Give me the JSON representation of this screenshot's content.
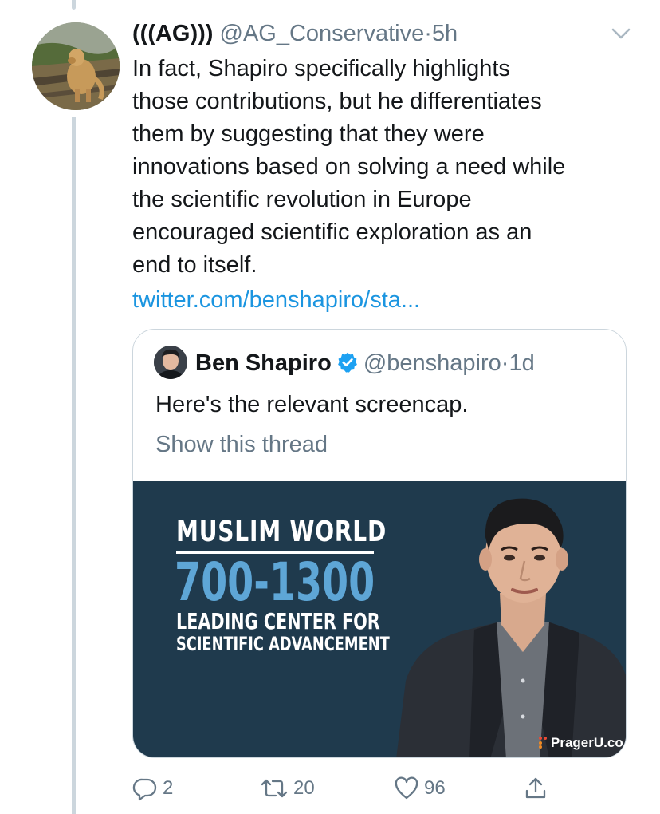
{
  "tweet": {
    "display_name": "(((AG)))",
    "handle": "@AG_Conservative",
    "separator": "·",
    "time": "5h",
    "text_lines": [
      "In fact, Shapiro specifically highlights",
      "those contributions, but he differentiates",
      "them by suggesting that they were",
      "innovations based on solving a need while",
      "the scientific revolution in Europe",
      "encouraged scientific exploration as an",
      "end to itself."
    ],
    "link": "twitter.com/benshapiro/sta...",
    "avatar_icon": "dog-photo-avatar",
    "menu_icon": "chevron-down-icon"
  },
  "quote": {
    "display_name": "Ben Shapiro",
    "handle": "@benshapiro",
    "separator": "·",
    "time": "1d",
    "text": "Here's the relevant screencap.",
    "show_thread": "Show this thread",
    "verified_icon": "verified-badge-icon",
    "verified_color": "#1da1f2",
    "media": {
      "title": "MUSLIM WORLD",
      "years": "700-1300",
      "subtitle_line1": "LEADING CENTER FOR",
      "subtitle_line2": "SCIENTIFIC ADVANCEMENT",
      "watermark": "PragerU.co",
      "background_color": "#1f3a4d",
      "years_color": "#5ea6d6"
    }
  },
  "actions": {
    "reply_count": "2",
    "retweet_count": "20",
    "like_count": "96",
    "reply_icon": "reply-icon",
    "retweet_icon": "retweet-icon",
    "like_icon": "heart-icon",
    "share_icon": "share-icon"
  },
  "colors": {
    "link": "#1b95e0",
    "secondary_text": "#657786",
    "border": "#ccd6dd"
  }
}
